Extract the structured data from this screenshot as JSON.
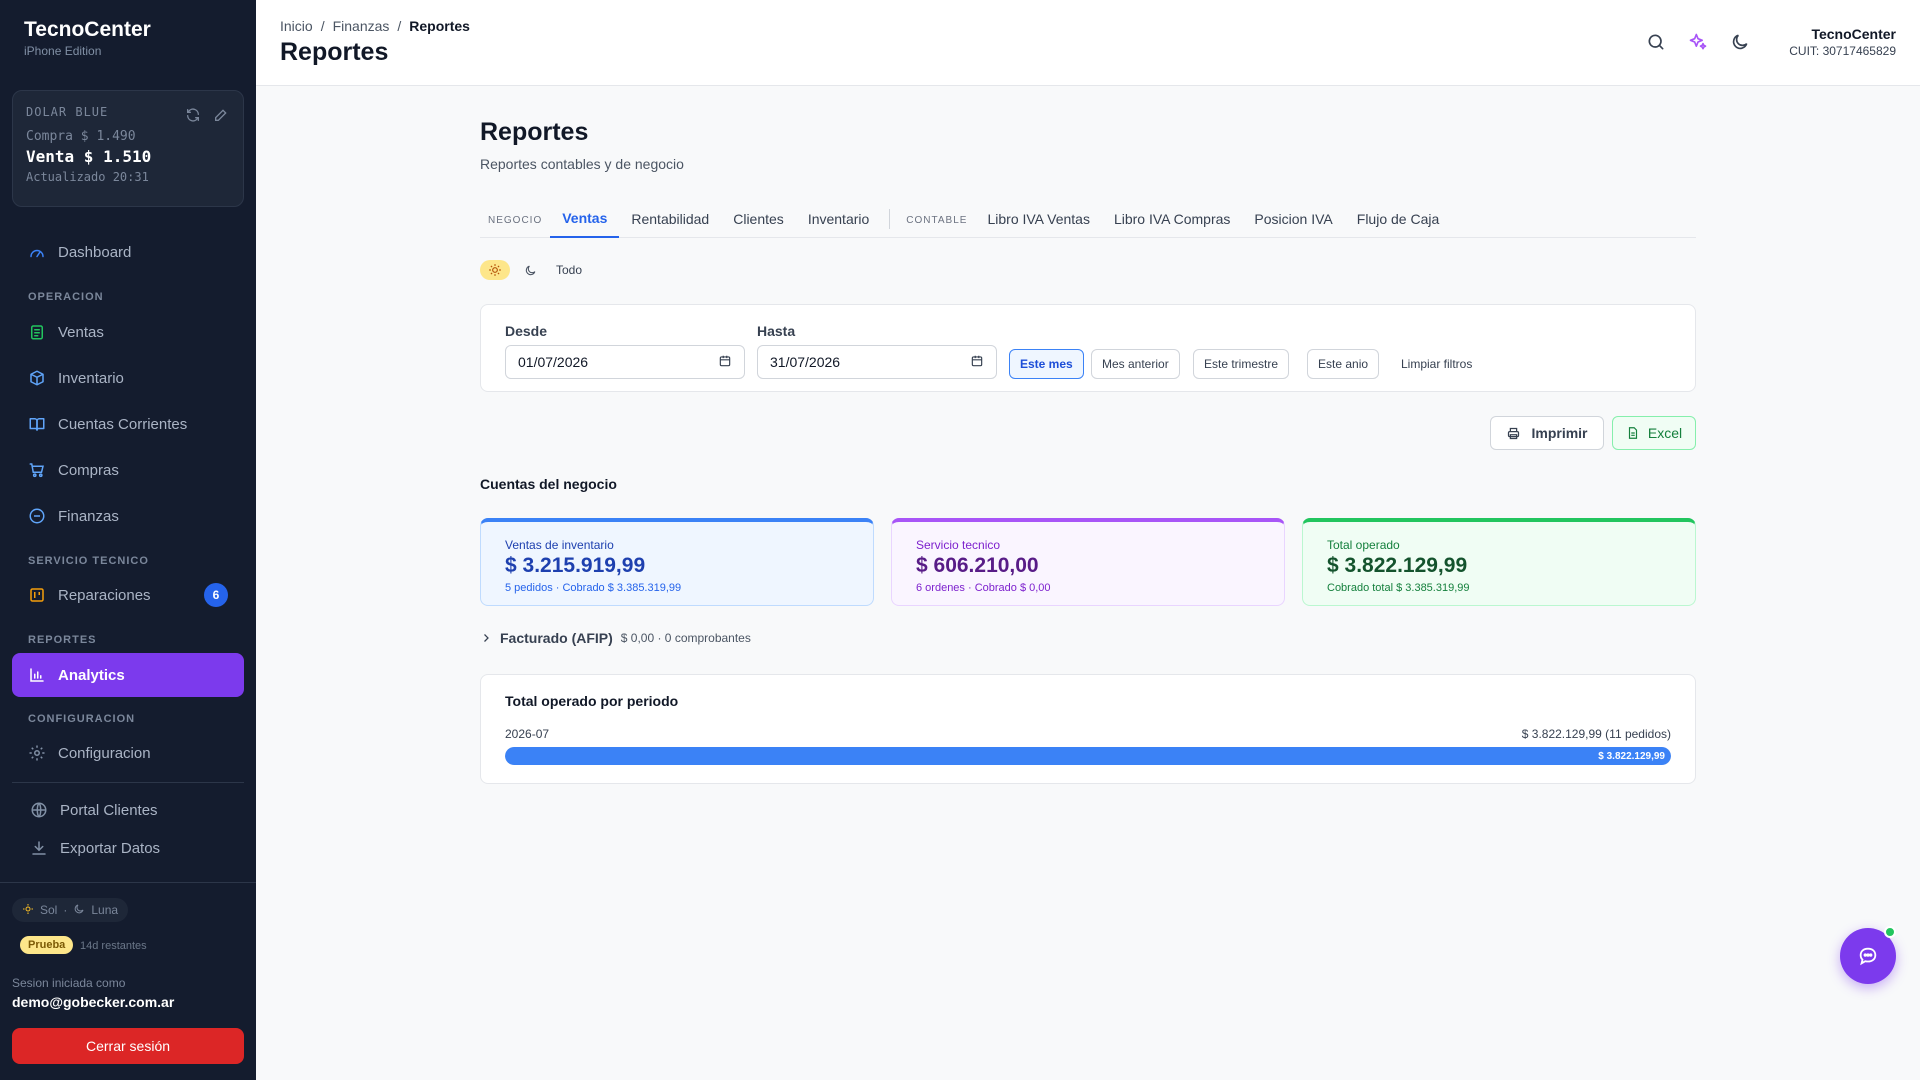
{
  "sidebar": {
    "brand_title": "TecnoCenter",
    "brand_subtitle": "iPhone Edition",
    "dolar": {
      "title": "DOLAR BLUE",
      "compra": "Compra $ 1.490",
      "venta": "Venta $ 1.510",
      "updated": "Actualizado 20:31"
    },
    "dashboard": "Dashboard",
    "section_operacion": "OPERACION",
    "ventas": "Ventas",
    "inventario": "Inventario",
    "cuentas": "Cuentas Corrientes",
    "compras": "Compras",
    "finanzas": "Finanzas",
    "section_servicio": "SERVICIO TECNICO",
    "reparaciones": "Reparaciones",
    "reparaciones_count": "6",
    "section_reportes": "REPORTES",
    "analytics": "Analytics",
    "section_config": "CONFIGURACION",
    "configuracion": "Configuracion",
    "portal": "Portal Clientes",
    "exportar": "Exportar Datos",
    "theme_sol": "Sol",
    "theme_sep": "·",
    "theme_luna": "Luna",
    "prueba_badge": "Prueba",
    "restantes": "14d restantes",
    "sesion_label": "Sesion iniciada como",
    "sesion_email": "demo@gobecker.com.ar",
    "logout": "Cerrar sesión"
  },
  "header": {
    "breadcrumb": [
      "Inicio",
      "/",
      "Finanzas",
      "/",
      "Reportes"
    ],
    "title": "Reportes",
    "user_name": "TecnoCenter",
    "user_cuit": "CUIT: 30717465829"
  },
  "main": {
    "title": "Reportes",
    "subtitle": "Reportes contables y de negocio",
    "tab_group_negocio": "NEGOCIO",
    "tabs_negocio": [
      "Ventas",
      "Rentabilidad",
      "Clientes",
      "Inventario"
    ],
    "tab_group_contable": "CONTABLE",
    "tabs_contable": [
      "Libro IVA Ventas",
      "Libro IVA Compras",
      "Posicion IVA",
      "Flujo de Caja"
    ],
    "mode_all": "Todo",
    "filters": {
      "desde_label": "Desde",
      "desde_value": "01/07/2026",
      "hasta_label": "Hasta",
      "hasta_value": "31/07/2026",
      "presets": [
        "Este mes",
        "Mes anterior",
        "Este trimestre",
        "Este anio"
      ],
      "clear": "Limpiar filtros"
    },
    "print_label": "Imprimir",
    "excel_label": "Excel",
    "section_title": "Cuentas del negocio",
    "stats": {
      "inventario_label": "Ventas de inventario",
      "inventario_value": "$ 3.215.919,99",
      "inventario_sub": "5 pedidos · Cobrado $ 3.385.319,99",
      "servicio_label": "Servicio tecnico",
      "servicio_value": "$ 606.210,00",
      "servicio_sub": "6 ordenes · Cobrado $ 0,00",
      "total_label": "Total operado",
      "total_value": "$ 3.822.129,99",
      "total_sub": "Cobrado total $ 3.385.319,99"
    },
    "afip_title": "Facturado (AFIP)",
    "afip_detail": "$ 0,00 · 0 comprobantes",
    "period": {
      "title": "Total operado por periodo",
      "name": "2026-07",
      "total": "$ 3.822.129,99 (11 pedidos)",
      "bar_label": "$ 3.822.129,99",
      "fill_fraction": 1.0
    }
  },
  "colors": {
    "accent": "#7c3aed",
    "primary": "#2563eb",
    "sidebar_bg": "#141c2e",
    "danger": "#dc2626"
  }
}
